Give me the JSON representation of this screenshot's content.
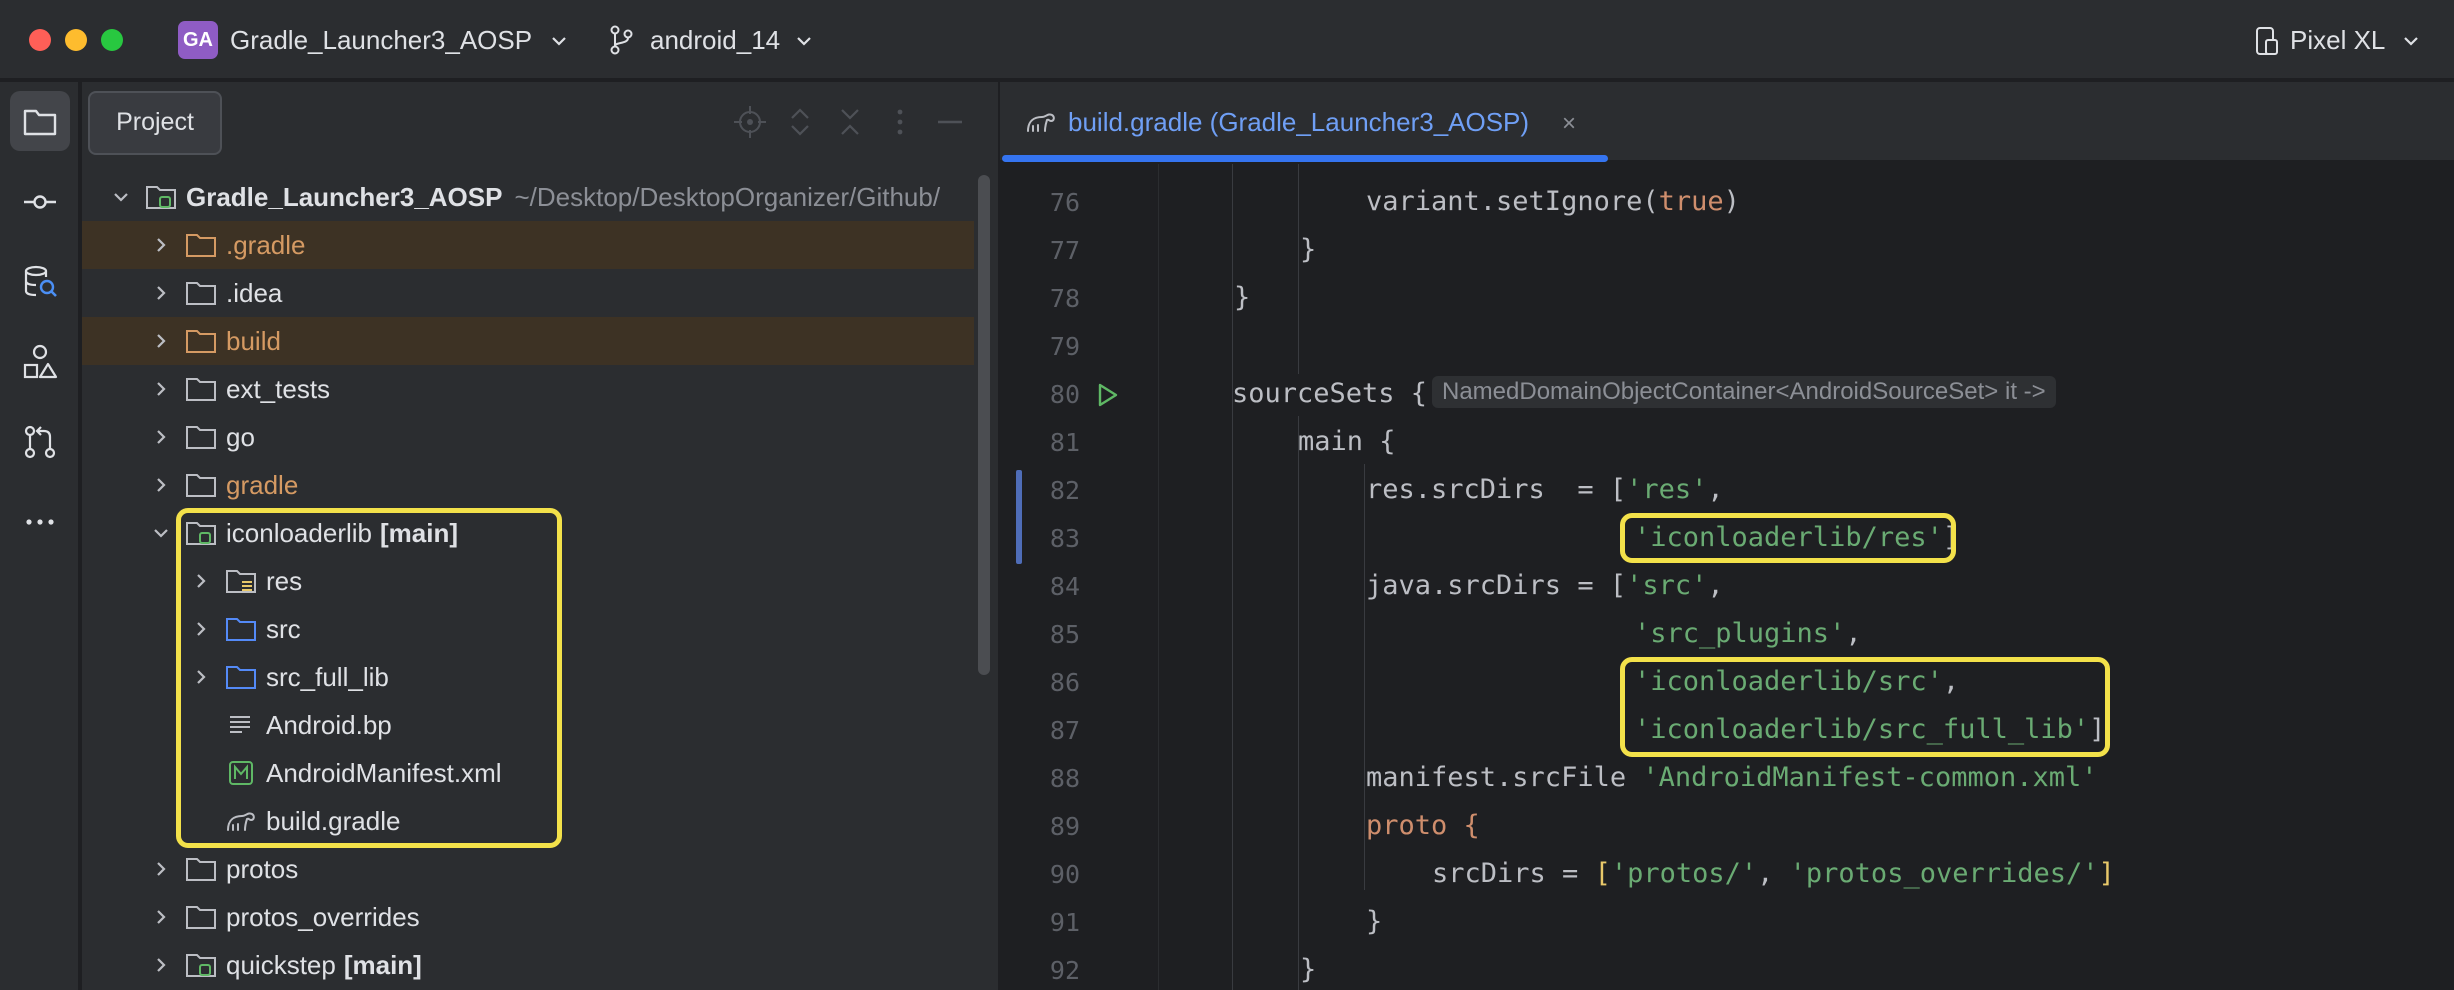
{
  "titlebar": {
    "project_badge": "GA",
    "project_name": "Gradle_Launcher3_AOSP",
    "branch": "android_14",
    "device": "Pixel XL"
  },
  "toolstrip": {
    "items": [
      "project-icon",
      "commit-icon",
      "data-explorer-icon",
      "structure-icon",
      "pull-requests-icon",
      "more-icon"
    ]
  },
  "tooltip": "Project",
  "tree": {
    "root_name": "Gradle_Launcher3_AOSP",
    "root_path": "~/Desktop/DesktopOrganizer/Github/",
    "items": [
      {
        "label": ".gradle"
      },
      {
        "label": ".idea"
      },
      {
        "label": "build"
      },
      {
        "label": "ext_tests"
      },
      {
        "label": "go"
      },
      {
        "label": "gradle"
      },
      {
        "label": "iconloaderlib",
        "suffix": "[main]"
      },
      {
        "label": "res"
      },
      {
        "label": "src"
      },
      {
        "label": "src_full_lib"
      },
      {
        "label": "Android.bp"
      },
      {
        "label": "AndroidManifest.xml"
      },
      {
        "label": "build.gradle"
      },
      {
        "label": "protos"
      },
      {
        "label": "protos_overrides"
      },
      {
        "label": "quickstep",
        "suffix": "[main]"
      }
    ]
  },
  "editor": {
    "tab_label": "build.gradle (Gradle_Launcher3_AOSP)",
    "tab_close": "×",
    "hint": "NamedDomainObjectContainer<AndroidSourceSet> it ->",
    "line_numbers": [
      "76",
      "77",
      "78",
      "79",
      "80",
      "81",
      "82",
      "83",
      "84",
      "85",
      "86",
      "87",
      "88",
      "89",
      "90",
      "91",
      "92"
    ],
    "code": {
      "l76a": "variant.setIgnore(",
      "l76b": "true",
      "l76c": ")",
      "l77": "}",
      "l78": "}",
      "l80": "sourceSets {",
      "l81": "main {",
      "l82a": "res.srcDirs  = [",
      "l82b": "'res'",
      "l82c": ",",
      "l83a": "'iconloaderlib/res'",
      "l83b": "]",
      "l84a": "java.srcDirs = [",
      "l84b": "'src'",
      "l84c": ",",
      "l85a": "'src_plugins'",
      "l85b": ",",
      "l86a": "'iconloaderlib/src'",
      "l86b": ",",
      "l87a": "'iconloaderlib/src_full_lib'",
      "l87b": "]",
      "l88a": "manifest.srcFile ",
      "l88b": "'AndroidManifest-common.xml'",
      "l89": "proto {",
      "l90a": "srcDirs = ",
      "l90b": "[",
      "l90c": "'protos/'",
      "l90d": ", ",
      "l90e": "'protos_overrides/'",
      "l90f": "]",
      "l91": "}",
      "l92": "}"
    }
  },
  "colors": {
    "accent": "#3574f0",
    "highlight": "#f3e14a",
    "excluded_bg": "#3d3224",
    "string": "#6aab73",
    "keyword": "#cf8e6d"
  }
}
